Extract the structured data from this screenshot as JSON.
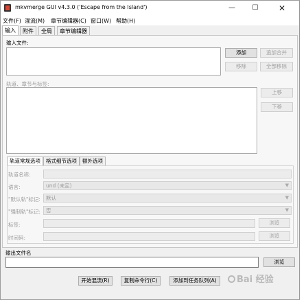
{
  "window": {
    "title": "mkvmerge GUI v4.3.0 ('Escape from the Island')",
    "minimize": "—",
    "maximize": "☐",
    "close": "✕"
  },
  "menu": [
    "文件(F)",
    "混流(M)",
    "章节编辑器(C)",
    "窗口(W)",
    "帮助(H)"
  ],
  "tabs": [
    "输入",
    "附件",
    "全局",
    "章节编辑器"
  ],
  "input": {
    "files_label": "输入文件:",
    "add": "添加",
    "append": "追加合并",
    "remove": "移除",
    "remove_all": "全部移除",
    "tracks_label": "轨道、章节与标签:",
    "up": "上移",
    "down": "下移"
  },
  "subtabs": [
    "轨道常规选项",
    "格式细节选项",
    "额外选项"
  ],
  "track_options": {
    "name_label": "轨道名称:",
    "language_label": "语言:",
    "language_value": "und (未定)",
    "default_label": "\"默认轨\"标记:",
    "default_value": "默认",
    "forced_label": "\"强制轨\"标记:",
    "forced_value": "否",
    "tags_label": "标签:",
    "tags_browse": "浏览",
    "timecodes_label": "时间码:",
    "timecodes_browse": "浏览"
  },
  "output": {
    "label": "输出文件名",
    "browse": "浏览"
  },
  "actions": {
    "start": "开始混流(R)",
    "copy": "复制命令行(C)",
    "queue": "添加到任务队列(A)"
  },
  "watermark": "Bai 经验"
}
